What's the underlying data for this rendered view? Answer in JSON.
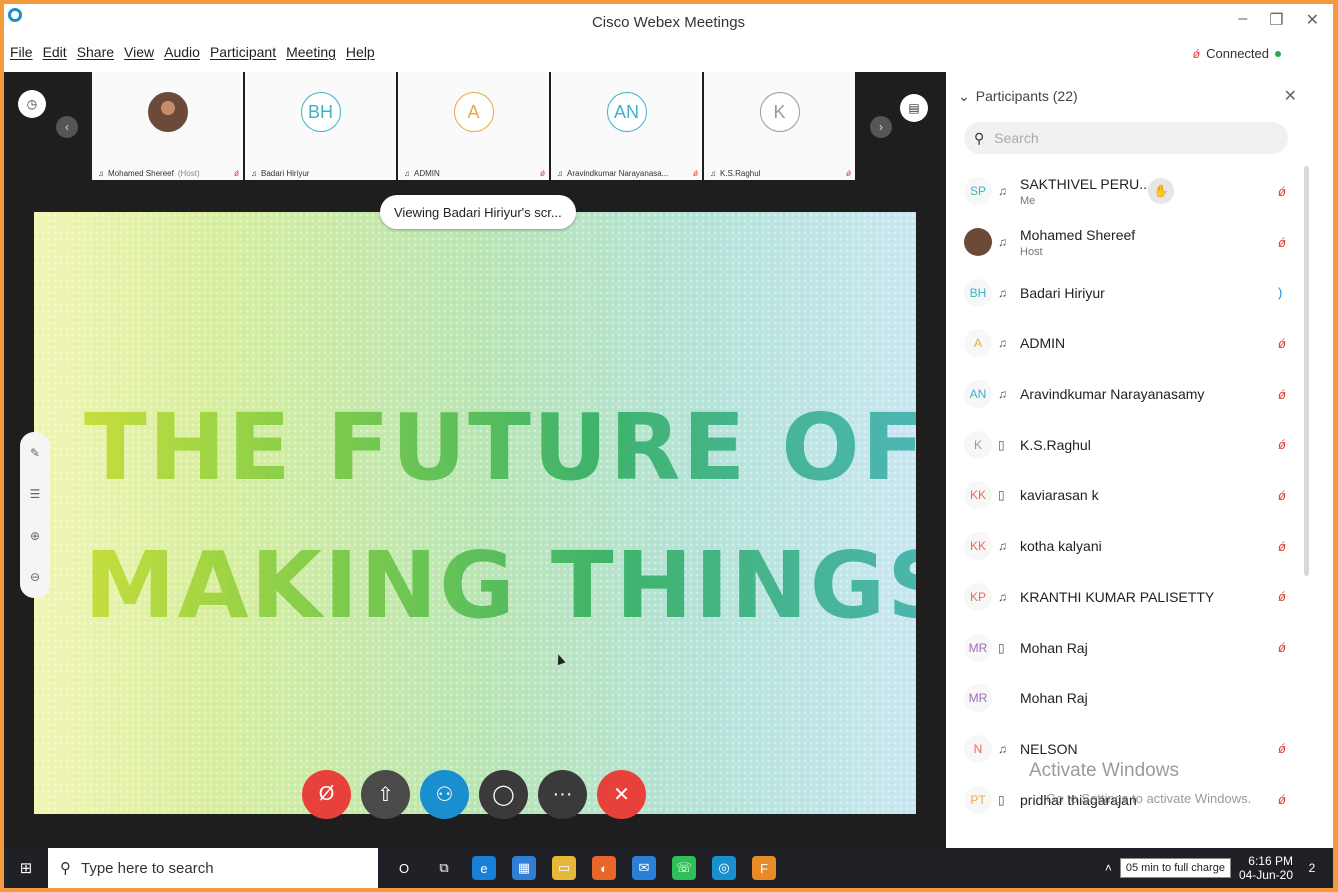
{
  "window": {
    "title": "Cisco Webex Meetings",
    "controls": [
      "–",
      "❐",
      "✕"
    ]
  },
  "menu": [
    "File",
    "Edit",
    "Share",
    "View",
    "Audio",
    "Participant",
    "Meeting",
    "Help"
  ],
  "status": {
    "connected": "Connected"
  },
  "strip": {
    "tiles": [
      {
        "initials": "",
        "name": "Mohamed Shereef",
        "role": "(Host)",
        "muted": true,
        "photo": true
      },
      {
        "initials": "BH",
        "name": "Badari Hiriyur",
        "role": "",
        "muted": false,
        "color": "#3fb1c4"
      },
      {
        "initials": "A",
        "name": "ADMIN",
        "role": "",
        "muted": true,
        "color": "#e8a93c"
      },
      {
        "initials": "AN",
        "name": "Aravindkumar Narayanasa...",
        "role": "",
        "muted": true,
        "color": "#3fb1c4"
      },
      {
        "initials": "K",
        "name": "K.S.Raghul",
        "role": "",
        "muted": true,
        "color": "#999999"
      }
    ]
  },
  "share": {
    "banner": "Viewing Badari Hiriyur's scr...",
    "line1": "THE FUTURE OF",
    "line2": "MAKING THINGS"
  },
  "controls": [
    {
      "name": "mute-button",
      "icon": "mic-off",
      "color": "#e8403a",
      "glyph": "Ø"
    },
    {
      "name": "share-button",
      "icon": "share",
      "color": "#4a4a4a",
      "glyph": "⇧"
    },
    {
      "name": "participants-button",
      "icon": "participants",
      "color": "#1a8fd0",
      "glyph": "⚇"
    },
    {
      "name": "chat-button",
      "icon": "chat",
      "color": "#3a3a3a",
      "glyph": "◯"
    },
    {
      "name": "more-button",
      "icon": "more",
      "color": "#3a3a3a",
      "glyph": "···"
    },
    {
      "name": "leave-button",
      "icon": "close",
      "color": "#e8403a",
      "glyph": "✕"
    }
  ],
  "panel": {
    "title": "Participants (22)",
    "search_placeholder": "Search",
    "participants": [
      {
        "initials": "SP",
        "color": "#3fb1c4",
        "device": "headset",
        "name": "SAKTHIVEL PERU...",
        "sub": "Me",
        "mute": "mic-off",
        "hand": true
      },
      {
        "initials": "",
        "color": "#6b4a3a",
        "device": "headset",
        "name": "Mohamed Shereef",
        "sub": "Host",
        "mute": "mic-off",
        "photo": true
      },
      {
        "initials": "BH",
        "color": "#3fb1c4",
        "device": "headset",
        "name": "Badari Hiriyur",
        "sub": "",
        "mute": "speaking"
      },
      {
        "initials": "A",
        "color": "#e8a93c",
        "device": "headset",
        "name": "ADMIN",
        "sub": "",
        "mute": "mic-off"
      },
      {
        "initials": "AN",
        "color": "#3fb1c4",
        "device": "headset",
        "name": "Aravindkumar Narayanasamy",
        "sub": "",
        "mute": "mic-off"
      },
      {
        "initials": "K",
        "color": "#999999",
        "device": "phone",
        "name": "K.S.Raghul",
        "sub": "",
        "mute": "mic-off"
      },
      {
        "initials": "KK",
        "color": "#e96a5c",
        "device": "phone",
        "name": "kaviarasan k",
        "sub": "",
        "mute": "mic-off"
      },
      {
        "initials": "KK",
        "color": "#e96a5c",
        "device": "headset",
        "name": "kotha kalyani",
        "sub": "",
        "mute": "mic-off"
      },
      {
        "initials": "KP",
        "color": "#e96a5c",
        "device": "headset",
        "name": "KRANTHI KUMAR PALISETTY",
        "sub": "",
        "mute": "mic-off"
      },
      {
        "initials": "MR",
        "color": "#a06bc4",
        "device": "phone",
        "name": "Mohan Raj",
        "sub": "",
        "mute": "mic-off"
      },
      {
        "initials": "MR",
        "color": "#a06bc4",
        "device": "",
        "name": "Mohan Raj",
        "sub": "",
        "mute": ""
      },
      {
        "initials": "N",
        "color": "#e96a5c",
        "device": "headset",
        "name": "NELSON",
        "sub": "",
        "mute": "mic-off"
      },
      {
        "initials": "PT",
        "color": "#e8a93c",
        "device": "phone",
        "name": "pridhar thiagarajan",
        "sub": "",
        "mute": "mic-off"
      }
    ]
  },
  "watermark": {
    "line1": "Activate Windows",
    "line2": "Go to Settings to activate Windows."
  },
  "taskbar": {
    "search_placeholder": "Type here to search",
    "apps": [
      {
        "name": "cortana-icon",
        "glyph": "O",
        "color": "transparent"
      },
      {
        "name": "task-view-icon",
        "glyph": "⧉",
        "color": "transparent"
      },
      {
        "name": "edge-icon",
        "glyph": "e",
        "color": "#1a7fd6"
      },
      {
        "name": "store-icon",
        "glyph": "▦",
        "color": "#2f7fd6"
      },
      {
        "name": "file-explorer-icon",
        "glyph": "▭",
        "color": "#e7b73a"
      },
      {
        "name": "firefox-icon",
        "glyph": "◐",
        "color": "#e8662a"
      },
      {
        "name": "mail-icon",
        "glyph": "✉",
        "color": "#2a80d6"
      },
      {
        "name": "whatsapp-icon",
        "glyph": "☏",
        "color": "#2fbf5a"
      },
      {
        "name": "webex-icon",
        "glyph": "◎",
        "color": "#1a8fd0"
      },
      {
        "name": "fusion-icon",
        "glyph": "F",
        "color": "#e88a2a"
      }
    ],
    "battery_tooltip": "05 min to full charge",
    "time": "6:16 PM",
    "date": "04-Jun-20",
    "notifications": "2"
  }
}
